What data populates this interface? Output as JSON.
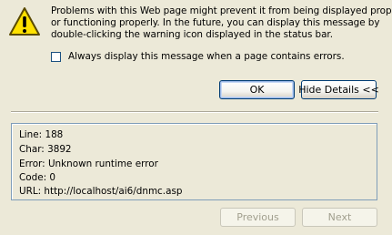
{
  "icon": "warning-icon",
  "message_lines": [
    "Problems with this Web page might prevent it from being displayed properly",
    "or functioning properly. In the future, you can display this message by",
    "double-clicking the warning icon displayed in the status bar."
  ],
  "checkbox": {
    "label": "Always display this message when a page contains errors.",
    "checked": false
  },
  "buttons": {
    "ok": "OK",
    "hide_details": "Hide Details <<",
    "previous": "Previous",
    "next": "Next"
  },
  "details": {
    "line": "Line:  188",
    "char": "Char:  3892",
    "error": "Error:  Unknown runtime error",
    "code": "Code: 0",
    "url": "URL:  http://localhost/ai6/dnmc.asp"
  },
  "colors": {
    "window_bg": "#ECE9D8",
    "warning_yellow": "#FFE100"
  }
}
